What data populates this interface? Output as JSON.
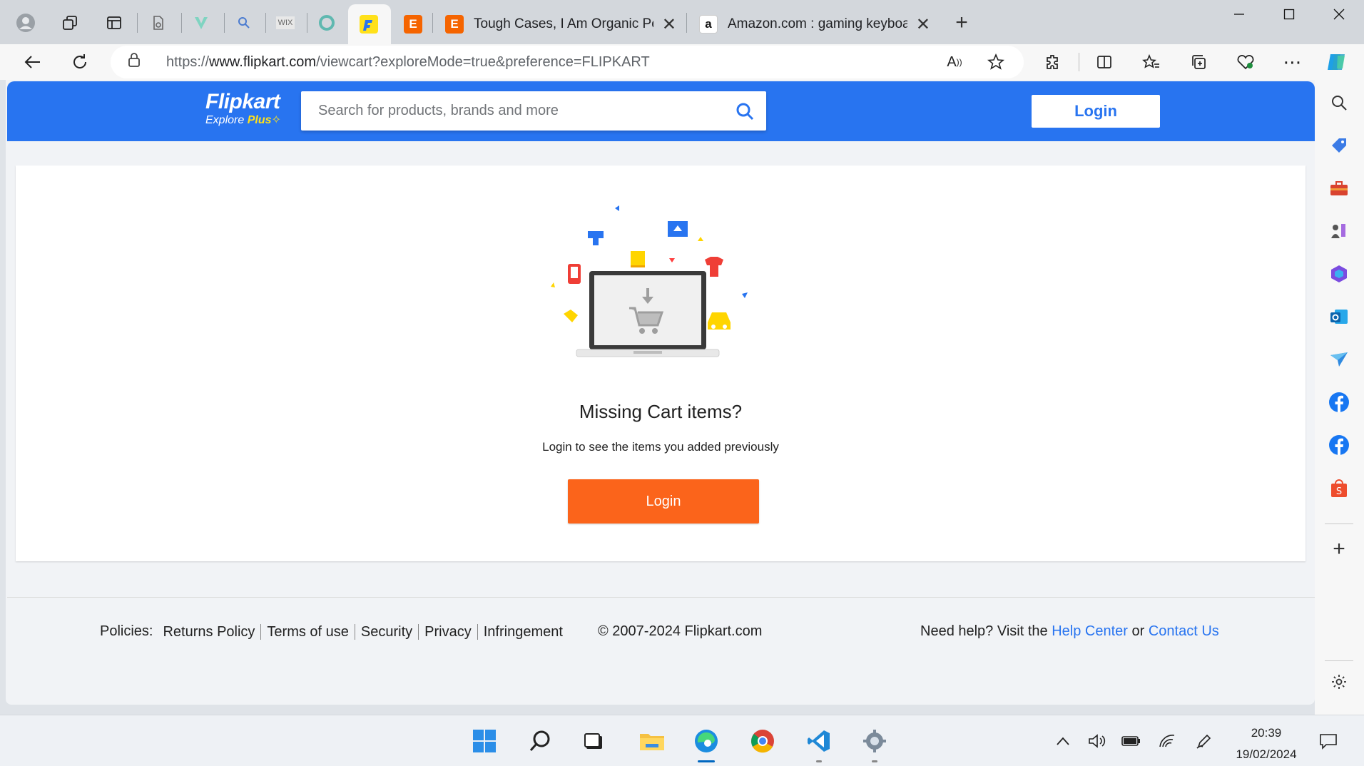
{
  "browser": {
    "tabs": [
      {
        "title": "Tough Cases, I Am Organic Peace",
        "favicon_letter": "E",
        "favicon_color": "#f56400"
      },
      {
        "title": "Amazon.com : gaming keyboard",
        "favicon_letter": "a",
        "favicon_color": "#111111"
      }
    ],
    "pinned_favicons": {
      "wix": "WIX",
      "etsy": "E"
    },
    "url_prefix": "https://",
    "url_host": "www.flipkart.com",
    "url_path": "/viewcart?exploreMode=true&preference=FLIPKART"
  },
  "header": {
    "logo_name": "Flipkart",
    "logo_sub": "Explore",
    "logo_plus": "Plus",
    "search_placeholder": "Search for products, brands and more",
    "login_label": "Login"
  },
  "empty_cart": {
    "title": "Missing Cart items?",
    "subtitle": "Login to see the items you added previously",
    "cta_label": "Login"
  },
  "footer": {
    "policies_label": "Policies:",
    "policy_links": [
      "Returns Policy",
      "Terms of use",
      "Security",
      "Privacy",
      "Infringement"
    ],
    "copyright": "© 2007-2024 Flipkart.com",
    "help_prefix": "Need help? Visit the",
    "help_center": "Help Center",
    "or": "or",
    "contact_us": "Contact Us"
  },
  "taskbar": {
    "time": "20:39",
    "date": "19/02/2024"
  },
  "colors": {
    "brand_blue": "#2874f0",
    "cta_orange": "#fb641b",
    "plus_yellow": "#ffe11b"
  }
}
